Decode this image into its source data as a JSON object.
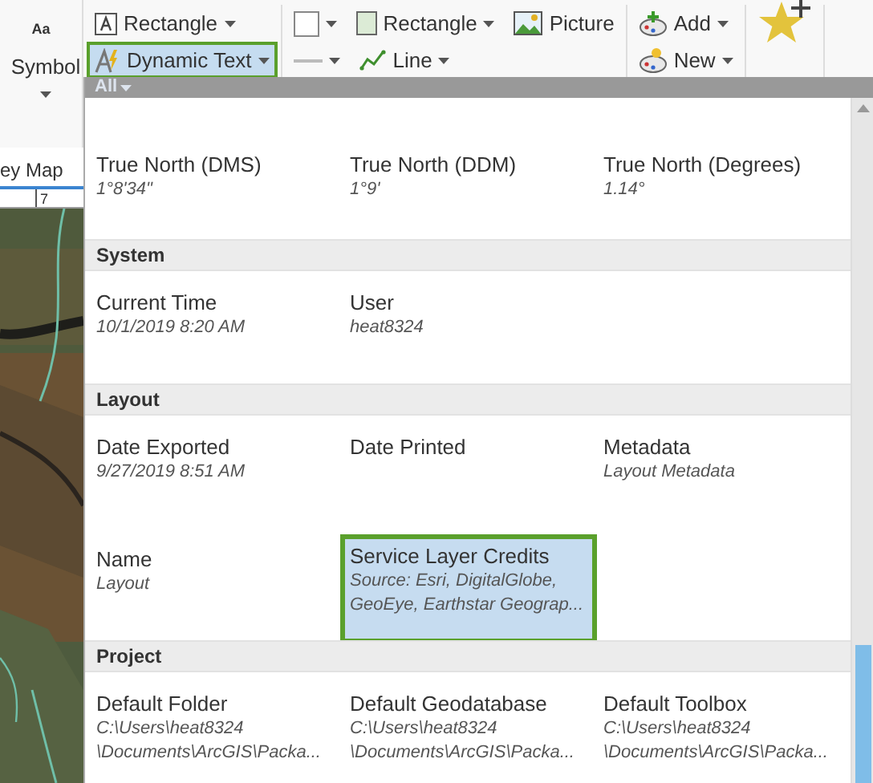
{
  "ribbon": {
    "symbol": {
      "icon_text": "Aa",
      "label": "Symbol"
    },
    "groups": [
      {
        "rows": [
          [
            {
              "kind": "text-frame",
              "label": "Rectangle",
              "menu": true,
              "selected": false
            }
          ],
          [
            {
              "kind": "dynamic-text",
              "label": "Dynamic Text",
              "menu": true,
              "selected": true
            }
          ]
        ]
      },
      {
        "rows": [
          [
            {
              "kind": "fill-swatch",
              "menu": true,
              "selected": false
            },
            {
              "kind": "rectangle",
              "label": "Rectangle",
              "menu": true,
              "selected": false
            },
            {
              "kind": "picture",
              "label": "Picture",
              "menu": false,
              "selected": false
            }
          ],
          [
            {
              "kind": "line-style",
              "menu": true,
              "selected": false
            },
            {
              "kind": "line",
              "label": "Line",
              "menu": true,
              "selected": false
            }
          ]
        ]
      },
      {
        "rows": [
          [
            {
              "kind": "add",
              "label": "Add",
              "menu": true,
              "selected": false
            }
          ],
          [
            {
              "kind": "new",
              "label": "New",
              "menu": true,
              "selected": false
            }
          ]
        ]
      },
      {
        "rows": [
          [
            {
              "kind": "star",
              "menu": false,
              "selected": false
            }
          ]
        ]
      }
    ]
  },
  "map_view": {
    "tab": "ey Map",
    "ruler_label": "7"
  },
  "gallery": {
    "filter": "All",
    "sections": [
      {
        "items": [
          {
            "name": "True North (DMS)",
            "value": [
              "1°8'34\""
            ],
            "selected": false
          },
          {
            "name": "True North (DDM)",
            "value": [
              "1°9'"
            ],
            "selected": false
          },
          {
            "name": "True North (Degrees)",
            "value": [
              "1.14°"
            ],
            "selected": false
          }
        ]
      },
      {
        "title": "System",
        "items": [
          {
            "name": "Current Time",
            "value": [
              "10/1/2019 8:20 AM"
            ],
            "selected": false
          },
          {
            "name": "User",
            "value": [
              "heat8324"
            ],
            "selected": false
          }
        ]
      },
      {
        "title": "Layout",
        "items": [
          {
            "name": "Date Exported",
            "value": [
              "9/27/2019 8:51 AM"
            ],
            "selected": false
          },
          {
            "name": "Date Printed",
            "value": [],
            "selected": false
          },
          {
            "name": "Metadata",
            "value": [
              "Layout Metadata"
            ],
            "selected": false
          },
          {
            "name": "Name",
            "value": [
              "Layout"
            ],
            "selected": false
          },
          {
            "name": "Service Layer Credits",
            "value": [
              "Source: Esri, DigitalGlobe,",
              "GeoEye, Earthstar Geograp..."
            ],
            "selected": true
          }
        ]
      },
      {
        "title": "Project",
        "items": [
          {
            "name": "Default Folder",
            "value": [
              "C:\\Users\\heat8324",
              "\\Documents\\ArcGIS\\Packa..."
            ],
            "selected": false
          },
          {
            "name": "Default Geodatabase",
            "value": [
              "C:\\Users\\heat8324",
              "\\Documents\\ArcGIS\\Packa..."
            ],
            "selected": false
          },
          {
            "name": "Default Toolbox",
            "value": [
              "C:\\Users\\heat8324",
              "\\Documents\\ArcGIS\\Packa..."
            ],
            "selected": false
          }
        ]
      }
    ]
  }
}
